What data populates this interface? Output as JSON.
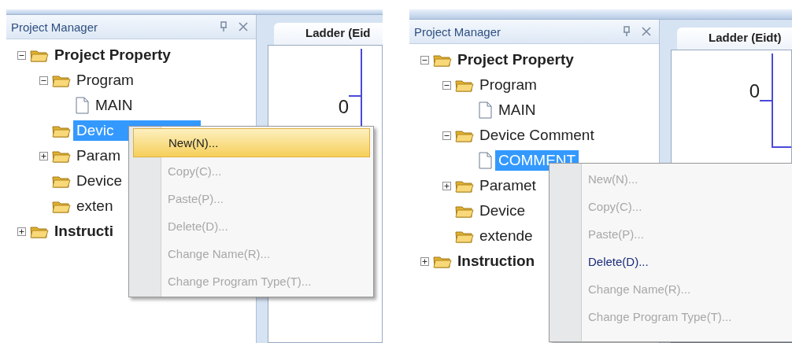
{
  "screens": [
    {
      "panel": {
        "title": "Project Manager"
      },
      "editor": {
        "tab": "Ladder (Eid",
        "row_number": "0"
      },
      "tree": [
        {
          "label": "Project Property",
          "kind": "folder",
          "expanded": true,
          "selected": false,
          "children": [
            {
              "label": "Program",
              "kind": "folder",
              "expanded": true,
              "selected": false,
              "children": [
                {
                  "label": "MAIN",
                  "kind": "file",
                  "selected": false
                }
              ]
            },
            {
              "label": "Devic",
              "kind": "folder",
              "selected": true
            },
            {
              "label": "Param",
              "kind": "folder",
              "expanded": false,
              "selected": false
            },
            {
              "label": "Device",
              "kind": "folder",
              "selected": false
            },
            {
              "label": "exten",
              "kind": "folder",
              "selected": false
            }
          ]
        },
        {
          "label": "Instructi",
          "kind": "folder",
          "expanded": false,
          "selected": false
        }
      ],
      "context_menu": {
        "items": [
          {
            "label": "New(N)...",
            "disabled": false,
            "selected": true
          },
          {
            "label": "Copy(C)...",
            "disabled": true,
            "selected": false
          },
          {
            "label": "Paste(P)...",
            "disabled": true,
            "selected": false
          },
          {
            "label": "Delete(D)...",
            "disabled": true,
            "selected": false
          },
          {
            "label": "Change Name(R)...",
            "disabled": true,
            "selected": false
          },
          {
            "label": "Change Program Type(T)...",
            "disabled": true,
            "selected": false
          }
        ]
      }
    },
    {
      "panel": {
        "title": "Project Manager"
      },
      "editor": {
        "tab": "Ladder (Eidt)",
        "row_number": "0"
      },
      "tree": [
        {
          "label": "Project Property",
          "kind": "folder",
          "expanded": true,
          "selected": false,
          "children": [
            {
              "label": "Program",
              "kind": "folder",
              "expanded": true,
              "selected": false,
              "children": [
                {
                  "label": "MAIN",
                  "kind": "file",
                  "selected": false
                }
              ]
            },
            {
              "label": "Device Comment",
              "kind": "folder",
              "expanded": true,
              "selected": false,
              "children": [
                {
                  "label": "COMMENT",
                  "kind": "file",
                  "selected": true
                }
              ]
            },
            {
              "label": "Paramet",
              "kind": "folder",
              "expanded": false,
              "selected": false
            },
            {
              "label": "Device",
              "kind": "folder",
              "selected": false
            },
            {
              "label": "extende",
              "kind": "folder",
              "selected": false
            }
          ]
        },
        {
          "label": "Instruction",
          "kind": "folder",
          "expanded": false,
          "selected": false
        }
      ],
      "context_menu": {
        "items": [
          {
            "label": "New(N)...",
            "disabled": true,
            "selected": false
          },
          {
            "label": "Copy(C)...",
            "disabled": true,
            "selected": false
          },
          {
            "label": "Paste(P)...",
            "disabled": true,
            "selected": false
          },
          {
            "label": "Delete(D)...",
            "disabled": false,
            "selected": false
          },
          {
            "label": "Change Name(R)...",
            "disabled": true,
            "selected": false
          },
          {
            "label": "Change Program Type(T)...",
            "disabled": true,
            "selected": false
          }
        ]
      }
    }
  ]
}
